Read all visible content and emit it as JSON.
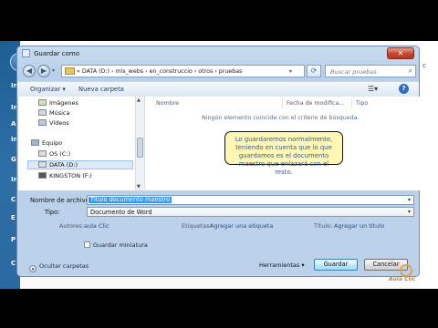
{
  "window": {
    "title": "Guardar como"
  },
  "background": {
    "strip_letters": [
      "In",
      "In",
      "A",
      "In",
      "G",
      "In",
      "C",
      "E",
      "P",
      "C"
    ],
    "right_text": "c",
    "logo_text": "Aula Clic"
  },
  "address": {
    "crumbs": "« DATA (D:) › mis_webs › en_construccio › otros › pruebas",
    "search_placeholder": "Buscar pruebas"
  },
  "toolbar": {
    "organize": "Organizar ▾",
    "new_folder": "Nueva carpeta"
  },
  "nav_pane": {
    "items": [
      {
        "label": "Imágenes",
        "icon": "images-icon"
      },
      {
        "label": "Música",
        "icon": "music-icon"
      },
      {
        "label": "Vídeos",
        "icon": "videos-icon"
      },
      {
        "label": "Equipo",
        "icon": "computer-icon"
      },
      {
        "label": "OS (C:)",
        "icon": "drive-icon"
      },
      {
        "label": "DATA (D:)",
        "icon": "drive-icon"
      },
      {
        "label": "KINGSTON (F:)",
        "icon": "usb-drive-icon"
      }
    ]
  },
  "file_list": {
    "columns": [
      "Nombre",
      "Fecha de modifica...",
      "Tipo"
    ],
    "empty_message": "Ningún elemento coincide con el criterio de búsqueda."
  },
  "tooltip": {
    "text": "Lo guardaremos normalmente, teniendo en cuenta que lo que guardamos es el documento maestro que enlazará con el resto."
  },
  "form": {
    "filename_label": "Nombre de archivo:",
    "filename_value": "Título documento maestro",
    "type_label": "Tipo:",
    "type_value": "Documento de Word",
    "authors_label": "Autores:",
    "authors_value": "aula Clic",
    "tags_label": "Etiquetas:",
    "tags_value": "Agregar una etiqueta",
    "title_label": "Título:",
    "title_value": "Agregar un título",
    "thumbnail_label": "Guardar miniatura"
  },
  "footer": {
    "hide_folders": "Ocultar carpetas",
    "tools": "Herramientas",
    "save": "Guardar",
    "cancel": "Cancelar"
  }
}
